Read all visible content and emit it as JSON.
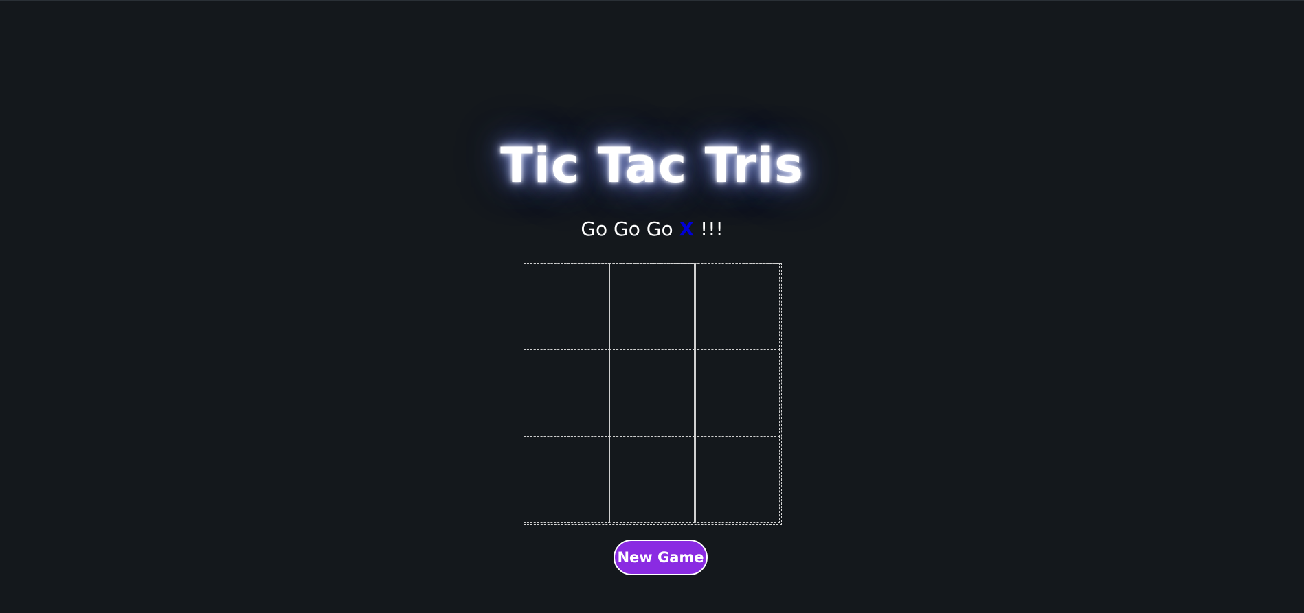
{
  "game": {
    "title": "Tic Tac Tris",
    "status": {
      "prefix": "Go Go Go ",
      "current_player": "X",
      "suffix": " !!!",
      "player_color": "#0000d6"
    },
    "board": {
      "cells": [
        "",
        "",
        "",
        "",
        "",
        "",
        "",
        "",
        ""
      ]
    },
    "new_game_label": "New Game",
    "button_color": "#8a2be2",
    "background_color": "#14181c"
  }
}
